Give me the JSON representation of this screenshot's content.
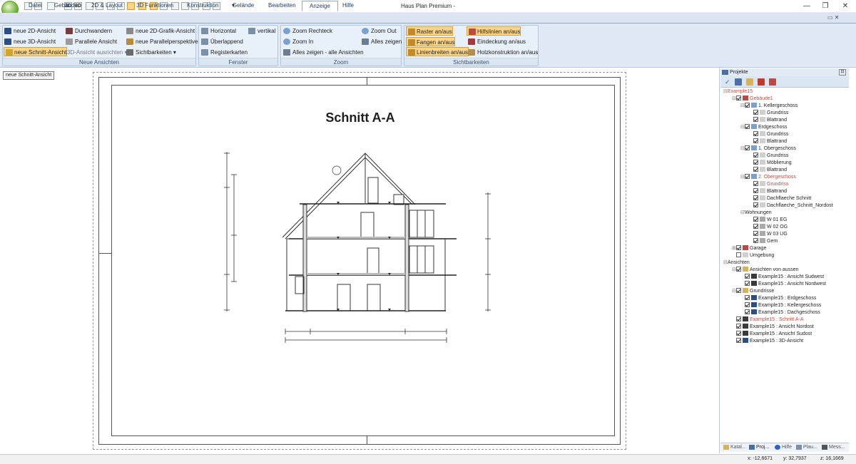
{
  "window": {
    "title": "Haus Plan Premium -",
    "minimize": "—",
    "restore": "❐",
    "close": "✕"
  },
  "quick_access": [
    "2D",
    "3D"
  ],
  "tabs": [
    "Datei",
    "Gebäude",
    "2D & Layout",
    "3D Funktionen",
    "Konstruktion",
    "Gelände",
    "Bearbeiten",
    "Anzeige",
    "Hilfe"
  ],
  "active_tab": "Anzeige",
  "ribbon": {
    "neue_ansichten": {
      "label": "Neue Ansichten",
      "items": [
        "neue 2D-Ansicht",
        "Durchwandern",
        "neue 2D-Grafik-Ansicht",
        "neue 3D-Ansicht",
        "Parallele Ansicht",
        "neue Parallelperspektive",
        "neue Schnitt-Ansicht",
        "3D-Ansicht ausrichten",
        "Sichtbarkeiten"
      ]
    },
    "fenster": {
      "label": "Fenster",
      "items": [
        "Horizontal",
        "vertikal",
        "Überlappend",
        "Registerkarten"
      ]
    },
    "zoom": {
      "label": "Zoom",
      "items": [
        "Zoom Rechteck",
        "Zoom Out",
        "Zoom In",
        "Alles zeigen",
        "Alles zeigen - alle Ansichten"
      ]
    },
    "sichtbarkeiten": {
      "label": "Sichtbarkeiten",
      "items": [
        "Raster an/aus",
        "Hilfslinien an/aus",
        "Fangen an/aus",
        "Eindeckung an/aus",
        "Linienbreiten an/aus",
        "Holzkonstruktion an/aus"
      ]
    }
  },
  "tooltip_chip": "neue Schnitt-Ansicht",
  "drawing": {
    "title": "Schnitt A-A"
  },
  "panel": {
    "title": "Projekte",
    "tree": [
      {
        "label": "Example15",
        "indent": 0,
        "red": true,
        "check": false,
        "exp": "⊟",
        "icon": ""
      },
      {
        "label": "Gebäude1",
        "indent": 1,
        "red": true,
        "check": true,
        "exp": "⊟",
        "icon": "house"
      },
      {
        "label": "1. Kellergeschoss",
        "indent": 2,
        "red": false,
        "check": true,
        "exp": "⊟",
        "icon": "floor"
      },
      {
        "label": "Grundriss",
        "indent": 3,
        "red": false,
        "check": true,
        "exp": "",
        "icon": "doc"
      },
      {
        "label": "Blattrand",
        "indent": 3,
        "red": false,
        "check": true,
        "exp": "",
        "icon": "doc"
      },
      {
        "label": "Erdgeschoss",
        "indent": 2,
        "red": false,
        "check": true,
        "exp": "⊟",
        "icon": "floor"
      },
      {
        "label": "Grundriss",
        "indent": 3,
        "red": false,
        "check": true,
        "exp": "",
        "icon": "doc"
      },
      {
        "label": "Blattrand",
        "indent": 3,
        "red": false,
        "check": true,
        "exp": "",
        "icon": "doc"
      },
      {
        "label": "1. Obergeschoss",
        "indent": 2,
        "red": false,
        "check": true,
        "exp": "⊟",
        "icon": "floor"
      },
      {
        "label": "Grundriss",
        "indent": 3,
        "red": false,
        "check": true,
        "exp": "",
        "icon": "doc"
      },
      {
        "label": "Möblierung",
        "indent": 3,
        "red": false,
        "check": true,
        "exp": "",
        "icon": "doc"
      },
      {
        "label": "Blattrand",
        "indent": 3,
        "red": false,
        "check": true,
        "exp": "",
        "icon": "doc"
      },
      {
        "label": "2. Obergeschoss",
        "indent": 2,
        "red": true,
        "check": true,
        "exp": "⊟",
        "icon": "floor"
      },
      {
        "label": "Grundriss",
        "indent": 3,
        "red": true,
        "check": true,
        "exp": "",
        "icon": "doc"
      },
      {
        "label": "Blattrand",
        "indent": 3,
        "red": false,
        "check": true,
        "exp": "",
        "icon": "doc"
      },
      {
        "label": "Dachflaeche Schnitt",
        "indent": 3,
        "red": false,
        "check": true,
        "exp": "",
        "icon": "doc"
      },
      {
        "label": "Dachflaeche_Schnitt_Nordost",
        "indent": 3,
        "red": false,
        "check": true,
        "exp": "",
        "icon": "doc"
      },
      {
        "label": "Wohnungen",
        "indent": 2,
        "red": false,
        "check": false,
        "exp": "⊟",
        "icon": ""
      },
      {
        "label": "W 01 EG",
        "indent": 3,
        "red": false,
        "check": true,
        "exp": "",
        "icon": "flat"
      },
      {
        "label": "W 02 OG",
        "indent": 3,
        "red": false,
        "check": true,
        "exp": "",
        "icon": "flat"
      },
      {
        "label": "W 03 UG",
        "indent": 3,
        "red": false,
        "check": true,
        "exp": "",
        "icon": "flat"
      },
      {
        "label": "Gem",
        "indent": 3,
        "red": false,
        "check": true,
        "exp": "",
        "icon": "flat"
      },
      {
        "label": "Garage",
        "indent": 1,
        "red": false,
        "check": true,
        "exp": "⊞",
        "icon": "house"
      },
      {
        "label": "Umgebung",
        "indent": 1,
        "red": false,
        "check": false,
        "exp": "",
        "icon": "doc"
      },
      {
        "label": "Ansichten",
        "indent": 0,
        "red": false,
        "check": false,
        "exp": "⊟",
        "icon": ""
      },
      {
        "label": "Ansichten von aussen",
        "indent": 1,
        "red": false,
        "check": true,
        "exp": "⊟",
        "icon": "folder"
      },
      {
        "label": "Example15 : Ansicht Sudwest",
        "indent": 2,
        "red": false,
        "check": true,
        "exp": "",
        "icon": "view"
      },
      {
        "label": "Example15 : Ansicht Nordwest",
        "indent": 2,
        "red": false,
        "check": true,
        "exp": "",
        "icon": "view"
      },
      {
        "label": "Grundrisse",
        "indent": 1,
        "red": false,
        "check": true,
        "exp": "⊟",
        "icon": "folder"
      },
      {
        "label": "Example15 : Erdgeschoss",
        "indent": 2,
        "red": false,
        "check": true,
        "exp": "",
        "icon": "2d"
      },
      {
        "label": "Example15 : Kellergeschoss",
        "indent": 2,
        "red": false,
        "check": true,
        "exp": "",
        "icon": "2d"
      },
      {
        "label": "Example15 : Dachgeschoss",
        "indent": 2,
        "red": false,
        "check": true,
        "exp": "",
        "icon": "2d"
      },
      {
        "label": "Example15 : Schnitt A-A",
        "indent": 1,
        "red": true,
        "check": true,
        "exp": "",
        "icon": "view"
      },
      {
        "label": "Example15 : Ansicht Nordost",
        "indent": 1,
        "red": false,
        "check": true,
        "exp": "",
        "icon": "view"
      },
      {
        "label": "Example15 : Ansicht Sudost",
        "indent": 1,
        "red": false,
        "check": true,
        "exp": "",
        "icon": "view"
      },
      {
        "label": "Example15 : 3D-Ansicht",
        "indent": 1,
        "red": false,
        "check": true,
        "exp": "",
        "icon": "3d"
      }
    ],
    "bottom_tabs": [
      "Katal...",
      "Proj...",
      "Hilfe",
      "Plau...",
      "Mess..."
    ]
  },
  "status": {
    "x": "x: -12,6671",
    "y": "y: 32,7937",
    "z": "z: 16,1669"
  }
}
